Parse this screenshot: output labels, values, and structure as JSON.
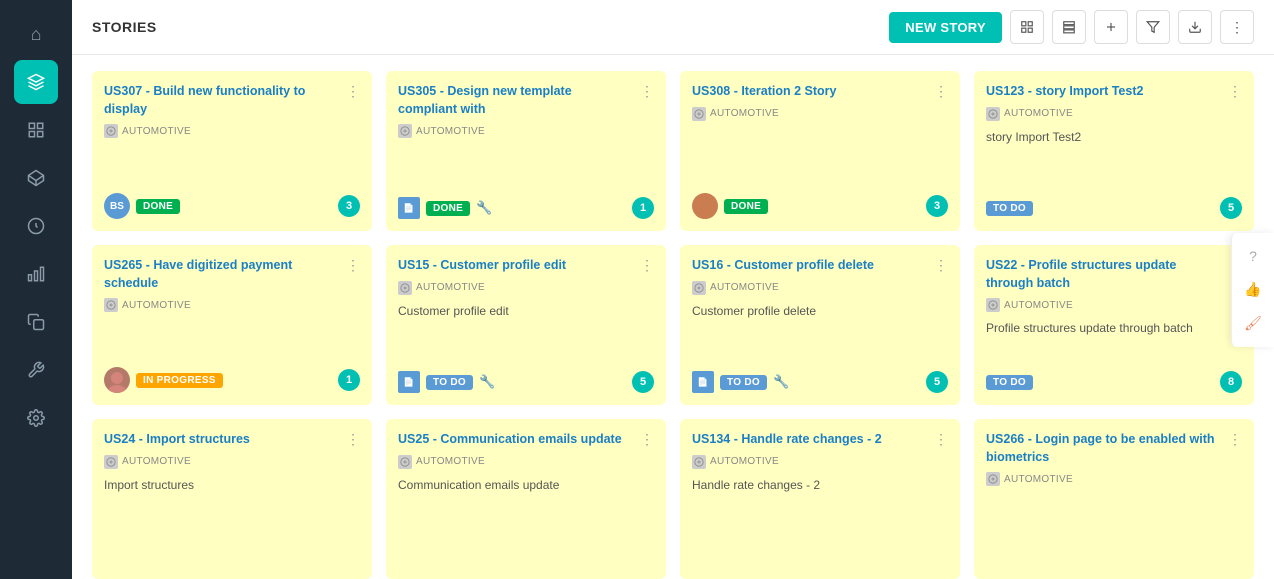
{
  "header": {
    "title": "STORIES",
    "new_story_label": "NEW STORY"
  },
  "sidebar": {
    "icons": [
      {
        "name": "home-icon",
        "symbol": "⌂",
        "active": false
      },
      {
        "name": "layers-icon",
        "symbol": "◫",
        "active": true
      },
      {
        "name": "grid-icon",
        "symbol": "⊞",
        "active": false
      },
      {
        "name": "cube-icon",
        "symbol": "⬡",
        "active": false
      },
      {
        "name": "circle-icon",
        "symbol": "◯",
        "active": false
      },
      {
        "name": "chart-icon",
        "symbol": "▦",
        "active": false
      },
      {
        "name": "copy-icon",
        "symbol": "⧉",
        "active": false
      },
      {
        "name": "wrench-icon",
        "symbol": "⚙",
        "active": false
      },
      {
        "name": "settings-icon",
        "symbol": "⚙",
        "active": false
      }
    ]
  },
  "cards": [
    {
      "id": "US307",
      "title": "US307 - Build new functionality to display",
      "tag": "AUTOMOTIVE",
      "body": "",
      "avatar_text": "BS",
      "avatar_type": "blue",
      "status": "DONE",
      "status_type": "done",
      "count": "3",
      "has_wrench": false,
      "has_doc": false
    },
    {
      "id": "US305",
      "title": "US305 - Design new template compliant with",
      "tag": "AUTOMOTIVE",
      "body": "",
      "avatar_text": "",
      "avatar_type": "doc",
      "status": "DONE",
      "status_type": "done",
      "count": "1",
      "has_wrench": true,
      "has_doc": true
    },
    {
      "id": "US308",
      "title": "US308 - Iteration 2 Story",
      "tag": "AUTOMOTIVE",
      "body": "",
      "avatar_text": "",
      "avatar_type": "photo",
      "status": "DONE",
      "status_type": "done",
      "count": "3",
      "has_wrench": false,
      "has_doc": false
    },
    {
      "id": "US123",
      "title": "US123 - story Import Test2",
      "tag": "AUTOMOTIVE",
      "body": "story Import Test2",
      "avatar_text": "",
      "avatar_type": "none",
      "status": "TO DO",
      "status_type": "todo",
      "count": "5",
      "has_wrench": false,
      "has_doc": false
    },
    {
      "id": "US265",
      "title": "US265 - Have digitized payment schedule",
      "tag": "AUTOMOTIVE",
      "body": "",
      "avatar_text": "",
      "avatar_type": "photo2",
      "status": "IN PROGRESS",
      "status_type": "inprogress",
      "count": "1",
      "has_wrench": false,
      "has_doc": false
    },
    {
      "id": "US15",
      "title": "US15 - Customer profile edit",
      "tag": "AUTOMOTIVE",
      "body": "Customer profile edit",
      "avatar_text": "",
      "avatar_type": "doc",
      "status": "TO DO",
      "status_type": "todo",
      "count": "5",
      "has_wrench": true,
      "has_doc": true
    },
    {
      "id": "US16",
      "title": "US16 - Customer profile delete",
      "tag": "AUTOMOTIVE",
      "body": "Customer profile delete",
      "avatar_text": "",
      "avatar_type": "doc",
      "status": "TO DO",
      "status_type": "todo",
      "count": "5",
      "has_wrench": true,
      "has_doc": true
    },
    {
      "id": "US22",
      "title": "US22 - Profile structures update through batch",
      "tag": "AUTOMOTIVE",
      "body": "Profile structures update through batch",
      "avatar_text": "",
      "avatar_type": "none",
      "status": "TO DO",
      "status_type": "todo",
      "count": "8",
      "has_wrench": false,
      "has_doc": false
    },
    {
      "id": "US24",
      "title": "US24 - Import structures",
      "tag": "AUTOMOTIVE",
      "body": "Import structures",
      "avatar_text": "",
      "avatar_type": "none",
      "status": "",
      "status_type": "none",
      "count": "",
      "has_wrench": false,
      "has_doc": false
    },
    {
      "id": "US25",
      "title": "US25 - Communication emails update",
      "tag": "AUTOMOTIVE",
      "body": "Communication emails update",
      "avatar_text": "",
      "avatar_type": "none",
      "status": "",
      "status_type": "none",
      "count": "",
      "has_wrench": false,
      "has_doc": false
    },
    {
      "id": "US134",
      "title": "US134 - Handle rate changes - 2",
      "tag": "AUTOMOTIVE",
      "body": "Handle rate changes - 2",
      "avatar_text": "",
      "avatar_type": "none",
      "status": "",
      "status_type": "none",
      "count": "",
      "has_wrench": false,
      "has_doc": false
    },
    {
      "id": "US266",
      "title": "US266 - Login page to be enabled with biometrics",
      "tag": "AUTOMOTIVE",
      "body": "",
      "avatar_text": "",
      "avatar_type": "none",
      "status": "",
      "status_type": "none",
      "count": "",
      "has_wrench": false,
      "has_doc": false
    }
  ],
  "right_panel": {
    "icons": [
      {
        "name": "question-icon",
        "symbol": "?"
      },
      {
        "name": "thumbup-icon",
        "symbol": "👍"
      },
      {
        "name": "paintbrush-icon",
        "symbol": "🖌"
      }
    ]
  }
}
